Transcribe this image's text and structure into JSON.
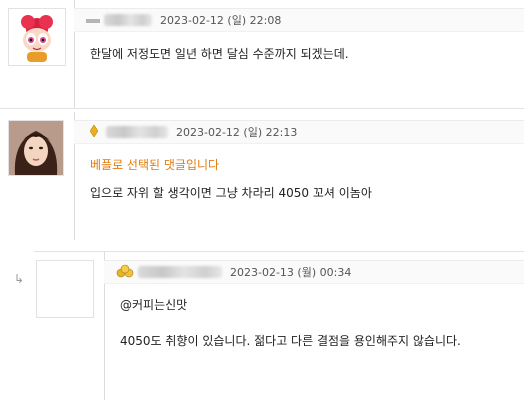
{
  "comments": [
    {
      "id": 1,
      "nickname_blurred": true,
      "date": "2023-02-12 (일) 22:08",
      "text": "한달에 저정도면 일년 하면 달심 수준까지 되겠는데."
    },
    {
      "id": 2,
      "nickname_blurred": true,
      "date": "2023-02-12 (일) 22:13",
      "best_label": "베플로 선택된 댓글입니다",
      "text": "입으로 자위 할 생각이면 그냥 차라리 4050 꼬셔 이놈아"
    },
    {
      "id": 3,
      "nickname_blurred": true,
      "date": "2023-02-13 (월) 00:34",
      "mention": "@커피는신맛",
      "text": "4050도 취향이 있습니다. 젊다고 다른 결점을 용인해주지 않습니다."
    }
  ],
  "reply_arrow": "↳",
  "colors": {
    "best_label": "#e07b0c",
    "meta_bg": "#fafafa",
    "border": "#dcdcdc"
  },
  "icons": {
    "comment1_level": "gray-bar-level-icon",
    "comment2_level": "gold-diamond-icon",
    "comment3_level": "gold-crown-icon"
  }
}
